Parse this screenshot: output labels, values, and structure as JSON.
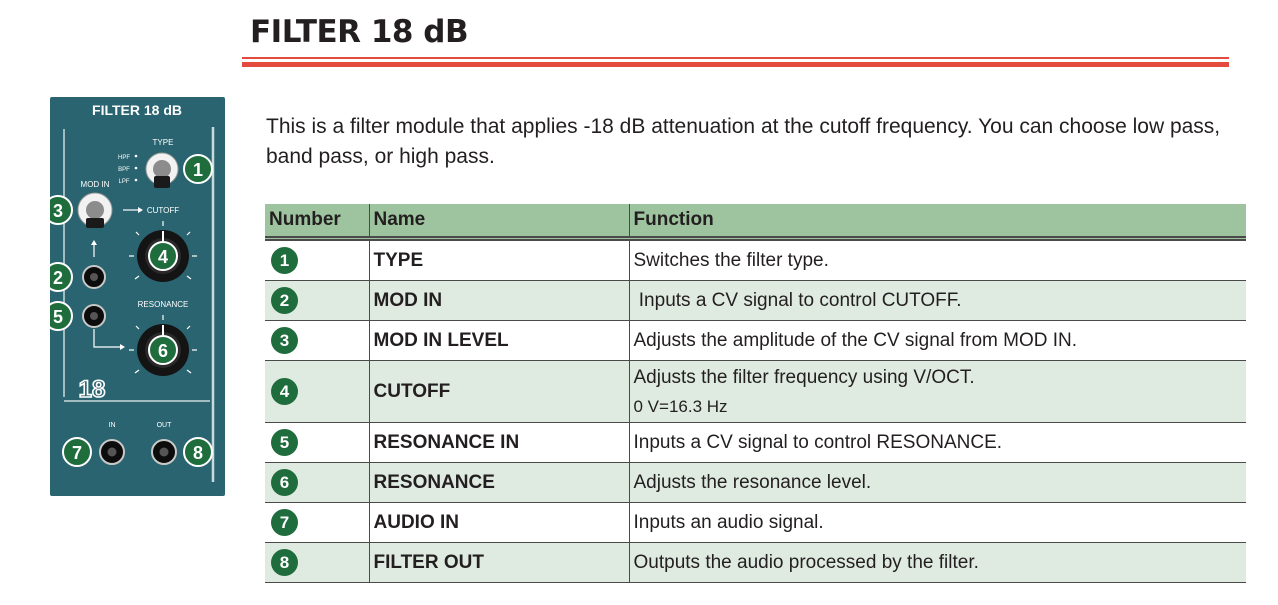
{
  "page": {
    "title": "FILTER 18 dB",
    "intro": "This is a filter module that applies -18 dB attenuation at the cutoff frequency. You can choose low pass, band pass, or high pass."
  },
  "module": {
    "title": "FILTER 18 dB",
    "type_label": "TYPE",
    "type_options": [
      "HPF",
      "BPF",
      "LPF"
    ],
    "mod_in_label": "MOD IN",
    "cutoff_label": "CUTOFF",
    "resonance_label": "RESONANCE",
    "badge_label": "18",
    "in_label": "IN",
    "out_label": "OUT",
    "callouts": [
      "1",
      "2",
      "3",
      "4",
      "5",
      "6",
      "7",
      "8"
    ]
  },
  "table": {
    "headers": [
      "Number",
      "Name",
      "Function"
    ],
    "rows": [
      {
        "number": "1",
        "name": "TYPE",
        "function": "Switches the filter type."
      },
      {
        "number": "2",
        "name": "MOD IN",
        "function": " Inputs a CV signal to control CUTOFF."
      },
      {
        "number": "3",
        "name": "MOD IN LEVEL",
        "function": "Adjusts the amplitude of the CV signal from MOD IN."
      },
      {
        "number": "4",
        "name": "CUTOFF",
        "function": "Adjusts the filter frequency using V/OCT.",
        "function_line2": "0 V=16.3 Hz"
      },
      {
        "number": "5",
        "name": "RESONANCE IN",
        "function": "Inputs a CV signal to control RESONANCE."
      },
      {
        "number": "6",
        "name": "RESONANCE",
        "function": "Adjusts the resonance level."
      },
      {
        "number": "7",
        "name": "AUDIO IN",
        "function": "Inputs an audio signal."
      },
      {
        "number": "8",
        "name": "FILTER OUT",
        "function": "Outputs the audio processed by the filter."
      }
    ]
  },
  "colors": {
    "accent_red": "#e34b3d",
    "module_teal": "#2a6470",
    "header_green": "#9ec49f",
    "row_alt": "#dfebe0",
    "badge_green": "#1f6d3c"
  }
}
